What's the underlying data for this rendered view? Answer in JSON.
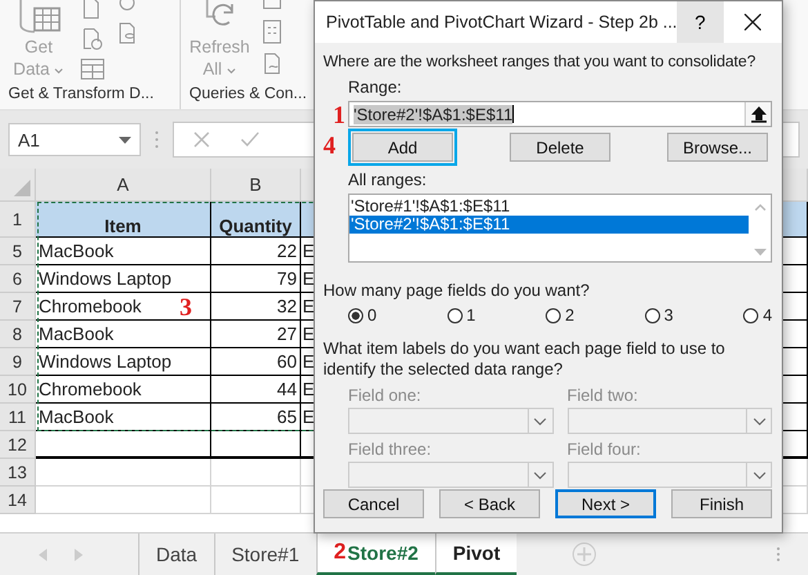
{
  "ribbon": {
    "buttons": [
      {
        "lines": [
          "Get",
          "Data"
        ]
      },
      {
        "lines": [
          "Refresh",
          "All"
        ]
      }
    ],
    "groups": [
      "Get & Transform D...",
      "Queries & Con..."
    ]
  },
  "name_box": "A1",
  "sheet": {
    "columns": [
      "A",
      "B"
    ],
    "rows": [
      {
        "number": "1",
        "kind": "header",
        "cells": [
          "Item",
          "Quantity"
        ]
      },
      {
        "number": "5",
        "kind": "data",
        "cells": [
          "MacBook",
          "22",
          "E"
        ]
      },
      {
        "number": "6",
        "kind": "data",
        "cells": [
          "Windows Laptop",
          "79",
          "E"
        ]
      },
      {
        "number": "7",
        "kind": "data",
        "cells": [
          "Chromebook",
          "32",
          "E"
        ],
        "annotation": "3"
      },
      {
        "number": "8",
        "kind": "data",
        "cells": [
          "MacBook",
          "27",
          "E"
        ]
      },
      {
        "number": "9",
        "kind": "data",
        "cells": [
          "Windows Laptop",
          "60",
          "E"
        ]
      },
      {
        "number": "10",
        "kind": "data",
        "cells": [
          "Chromebook",
          "44",
          "E"
        ]
      },
      {
        "number": "11",
        "kind": "data",
        "cells": [
          "MacBook",
          "65",
          "E"
        ]
      },
      {
        "number": "12",
        "kind": "last",
        "cells": []
      },
      {
        "number": "13",
        "kind": "empty",
        "cells": []
      },
      {
        "number": "14",
        "kind": "empty",
        "cells": []
      }
    ]
  },
  "sheet_tabs": [
    {
      "label": "Data",
      "selected": false,
      "active": false
    },
    {
      "label": "Store#1",
      "selected": false,
      "active": false
    },
    {
      "label": "Store#2",
      "selected": true,
      "active": true,
      "annotation": "2"
    },
    {
      "label": "Pivot",
      "selected": true,
      "active": false
    }
  ],
  "dialog": {
    "title": "PivotTable and PivotChart Wizard - Step 2b ...",
    "help": "?",
    "question": "Where are the worksheet ranges that you want to consolidate?",
    "range_label": "Range:",
    "range_value": "'Store#2'!$A$1:$E$11",
    "range_annotation": "1",
    "range_buttons": [
      {
        "label": "Add",
        "highlighted": true,
        "annotation": "4"
      },
      {
        "label": "Delete",
        "highlighted": false
      },
      {
        "label": "Browse...",
        "highlighted": false
      }
    ],
    "all_ranges_label": "All ranges:",
    "ranges": [
      {
        "text": "'Store#1'!$A$1:$E$11",
        "selected": false
      },
      {
        "text": "'Store#2'!$A$1:$E$11",
        "selected": true
      }
    ],
    "page_fields_question": "How many page fields do you want?",
    "page_field_options": [
      {
        "label": "0",
        "selected": true
      },
      {
        "label": "1",
        "selected": false
      },
      {
        "label": "2",
        "selected": false
      },
      {
        "label": "3",
        "selected": false
      },
      {
        "label": "4",
        "selected": false
      }
    ],
    "labels_question": "What item labels do you want each page field to use to identify the selected data range?",
    "fields": [
      {
        "label": "Field one:",
        "disabled": true
      },
      {
        "label": "Field two:",
        "disabled": true
      },
      {
        "label": "Field three:",
        "disabled": true
      },
      {
        "label": "Field four:",
        "disabled": true
      }
    ],
    "footer_buttons": [
      {
        "label": "Cancel",
        "default": false
      },
      {
        "label": "< Back",
        "default": false
      },
      {
        "label": "Next >",
        "default": true
      },
      {
        "label": "Finish",
        "default": false
      }
    ]
  }
}
